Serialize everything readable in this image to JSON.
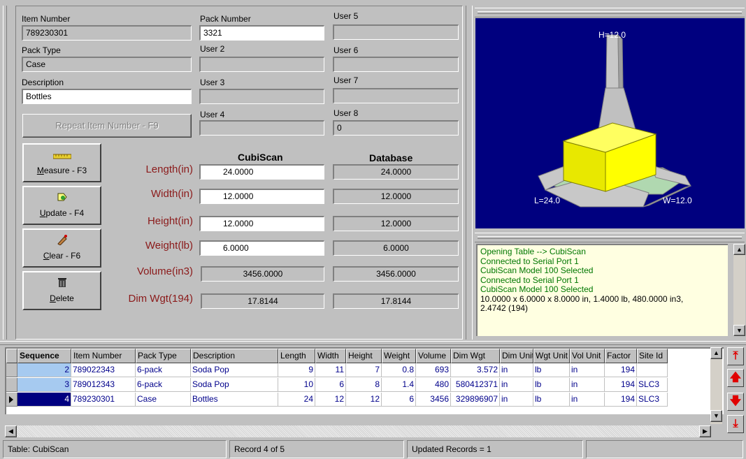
{
  "fields": {
    "item_number": {
      "label": "Item Number",
      "value": "789230301"
    },
    "pack_number": {
      "label": "Pack Number",
      "value": "3321"
    },
    "user5": {
      "label": "User 5",
      "value": ""
    },
    "pack_type": {
      "label": "Pack Type",
      "value": "Case"
    },
    "user2": {
      "label": "User 2",
      "value": ""
    },
    "user6": {
      "label": "User 6",
      "value": ""
    },
    "description": {
      "label": "Description",
      "value": "Bottles"
    },
    "user3": {
      "label": "User 3",
      "value": ""
    },
    "user7": {
      "label": "User 7",
      "value": ""
    },
    "user4": {
      "label": "User 4",
      "value": ""
    },
    "user8": {
      "label": "User 8",
      "value": "0"
    },
    "repeat_button": "Repeat Item Number - F9"
  },
  "buttons": {
    "measure": {
      "prefix": "",
      "key": "M",
      "rest": "easure - F3",
      "icon": "ruler-icon"
    },
    "update": {
      "prefix": "",
      "key": "U",
      "rest": "pdate - F4",
      "icon": "update-icon"
    },
    "clear": {
      "prefix": "",
      "key": "C",
      "rest": "lear - F6",
      "icon": "eraser-icon"
    },
    "delete": {
      "prefix": "",
      "key": "D",
      "rest": "elete",
      "icon": "trash-icon"
    }
  },
  "measure": {
    "col_cubiscan": "CubiScan",
    "col_database": "Database",
    "rows": [
      {
        "label": "Length(in)",
        "cubiscan": "24.0000",
        "database": "24.0000"
      },
      {
        "label": "Width(in)",
        "cubiscan": "12.0000",
        "database": "12.0000"
      },
      {
        "label": "Height(in)",
        "cubiscan": "12.0000",
        "database": "12.0000"
      },
      {
        "label": "Weight(lb)",
        "cubiscan": "6.0000",
        "database": "6.0000"
      },
      {
        "label": "Volume(in3)",
        "cubiscan": "3456.0000",
        "database": "3456.0000"
      },
      {
        "label": "Dim Wgt(194)",
        "cubiscan": "17.8144",
        "database": "17.8144"
      }
    ]
  },
  "view3d": {
    "h_label": "H=12.0",
    "l_label": "L=24.0",
    "w_label": "W=12.0",
    "bg_color": "#00007f",
    "box_color": "#ffff00"
  },
  "log": {
    "lines": [
      {
        "text": "Opening Table --> CubiScan",
        "color": "green"
      },
      {
        "text": "Connected to Serial Port 1",
        "color": "green"
      },
      {
        "text": "CubiScan Model 100 Selected",
        "color": "green"
      },
      {
        "text": "Connected to Serial Port 1",
        "color": "green"
      },
      {
        "text": "CubiScan Model 100 Selected",
        "color": "green"
      },
      {
        "text": "10.0000 x 6.0000 x 8.0000 in, 1.4000 lb, 480.0000 in3,",
        "color": "black"
      },
      {
        "text": "2.4742 (194)",
        "color": "black"
      }
    ]
  },
  "grid": {
    "columns": [
      "Sequence",
      "Item Number",
      "Pack Type",
      "Description",
      "Length",
      "Width",
      "Height",
      "Weight",
      "Volume",
      "Dim Wgt",
      "Dim Unit",
      "Wgt Unit",
      "Vol Unit",
      "Factor",
      "Site Id"
    ],
    "rows": [
      [
        "2",
        "789022343",
        "6-pack",
        "Soda Pop",
        "9",
        "11",
        "7",
        "0.8",
        "693",
        "3.572",
        "in",
        "lb",
        "in",
        "194",
        ""
      ],
      [
        "3",
        "789012343",
        "6-pack",
        "Soda Pop",
        "10",
        "6",
        "8",
        "1.4",
        "480",
        "580412371",
        "in",
        "lb",
        "in",
        "194",
        "SLC3"
      ],
      [
        "4",
        "789230301",
        "Case",
        "Bottles",
        "24",
        "12",
        "12",
        "6",
        "3456",
        "329896907",
        "in",
        "lb",
        "in",
        "194",
        "SLC3"
      ]
    ],
    "selected_row": 2
  },
  "status": {
    "table": "Table: CubiScan",
    "record": "Record 4 of 5",
    "updated": "Updated Records = 1",
    "extra": ""
  }
}
